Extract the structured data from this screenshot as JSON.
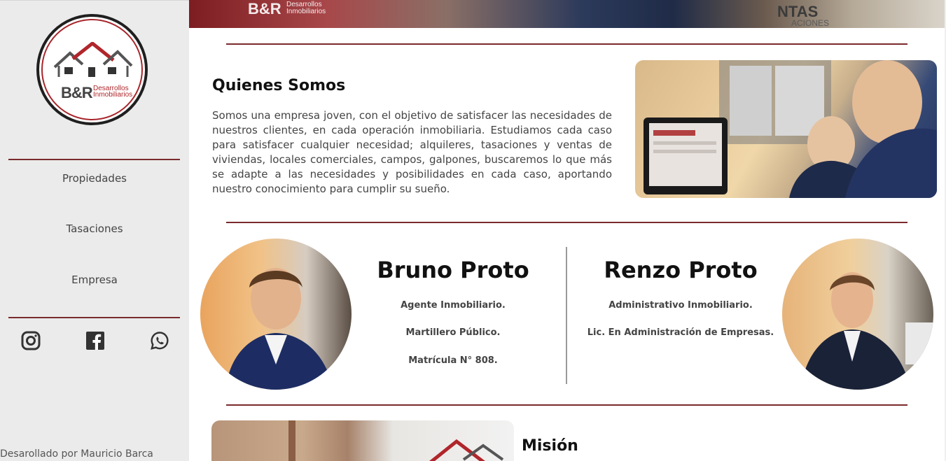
{
  "sidebar": {
    "logo": {
      "brand": "B&R",
      "sub_line1": "Desarrollos",
      "sub_line2": "Inmobiliarios"
    },
    "nav": [
      {
        "label": "Propiedades"
      },
      {
        "label": "Tasaciones"
      },
      {
        "label": "Empresa"
      }
    ],
    "social": [
      {
        "icon": "instagram-icon"
      },
      {
        "icon": "facebook-icon"
      },
      {
        "icon": "whatsapp-icon"
      }
    ],
    "credit": "Desarollado por Mauricio Barca"
  },
  "banner": {
    "brand": "B&R",
    "sub_line1": "Desarrollos",
    "sub_line2": "Inmobiliarios",
    "sign_line1": "NTAS",
    "sign_line2": "ACIONES"
  },
  "about": {
    "title": "Quienes Somos",
    "text": "Somos una empresa joven, con el objetivo de satisfacer las necesidades de nuestros clientes, en cada operación inmobiliaria. Estudiamos cada caso para satisfacer cualquier necesidad; alquileres, tasaciones y ventas de viviendas, locales comerciales, campos, galpones, buscaremos lo que más se adapte a las necesidades y posibilidades en cada caso, aportando nuestro conocimiento para cumplir su sueño."
  },
  "team": [
    {
      "name": "Bruno Proto",
      "lines": [
        "Agente Inmobiliario.",
        "Martillero Público.",
        "Matrícula N° 808."
      ]
    },
    {
      "name": "Renzo Proto",
      "lines": [
        "Administrativo Inmobiliario.",
        "Lic. En Administración de Empresas."
      ]
    }
  ],
  "mision": {
    "title": "Misión"
  },
  "colors": {
    "accent": "#7a2a2d",
    "sidebar_bg": "#ebebeb",
    "logo_red": "#a7262b"
  }
}
